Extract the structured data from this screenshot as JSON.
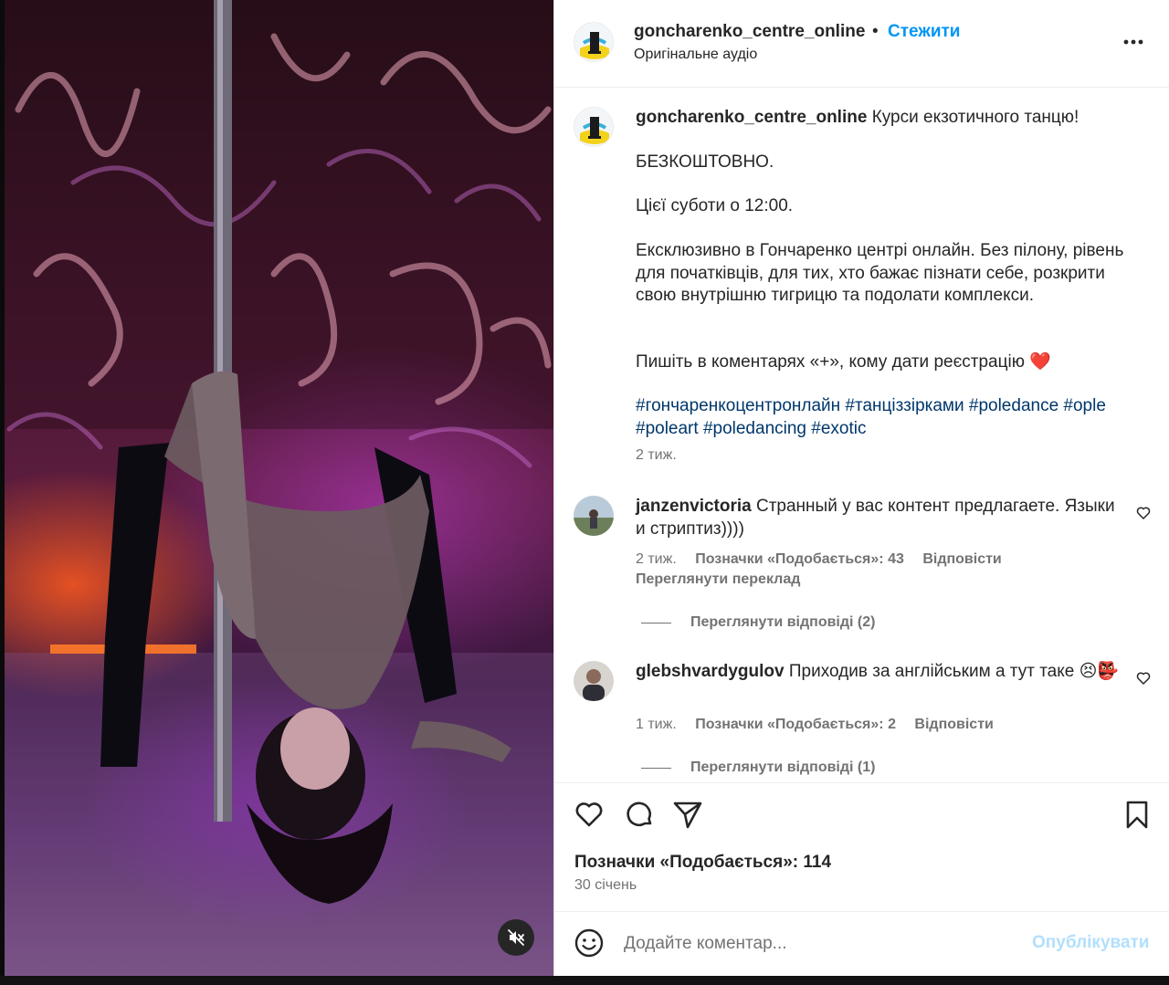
{
  "post": {
    "username": "goncharenko_centre_online",
    "separator": "•",
    "follow_label": "Стежити",
    "audio_label": "Оригінальне аудіо"
  },
  "caption": {
    "username": "goncharenko_centre_online",
    "line1": "Курси екзотичного танцю!",
    "line2": "БЕЗКОШТОВНО.",
    "line3": "Цієї суботи о 12:00.",
    "paragraph": "Ексклюзивно в Гончаренко центрі онлайн. Без пілону, рівень для початківців, для тих, хто бажає пізнати себе, розкрити свою внутрішню тигрицю та подолати комплекси.",
    "line5": "Пишіть в коментарях «+», кому дати реєстрацію",
    "line5_emoji": "❤️",
    "hashtags": "#гончаренкоцентронлайн #танціззірками #poledance #ople #poleart #poledancing #exotic",
    "time": "2 тиж."
  },
  "comments": [
    {
      "username": "janzenvictoria",
      "text": "Странный у вас контент предлагаете. Языки и стриптиз))))",
      "time": "2 тиж.",
      "likes": "Позначки «Подобається»: 43",
      "reply_label": "Відповісти",
      "translate_label": "Переглянути переклад",
      "view_replies": "Переглянути відповіді (2)"
    },
    {
      "username": "glebshvardygulov",
      "text": "Приходив за англійським а тут таке",
      "emoji": "😣👺",
      "time": "1 тиж.",
      "likes": "Позначки «Подобається»: 2",
      "reply_label": "Відповісти",
      "view_replies": "Переглянути відповіді (1)"
    }
  ],
  "actions": {
    "likes_count": "Позначки «Подобається»: 114",
    "date": "30 січень"
  },
  "add_comment": {
    "placeholder": "Додайте коментар...",
    "publish_label": "Опублікувати"
  },
  "icons": {
    "like": "heart-icon",
    "comment": "comment-icon",
    "share": "paper-plane-icon",
    "save": "bookmark-icon",
    "emoji": "emoji-icon",
    "more": "more-options-icon",
    "mute": "muted-speaker-icon"
  },
  "colors": {
    "accent": "#0095f6",
    "hashtag": "#00376b",
    "secondary_text": "#737373",
    "publish_disabled": "#b2dffc"
  }
}
